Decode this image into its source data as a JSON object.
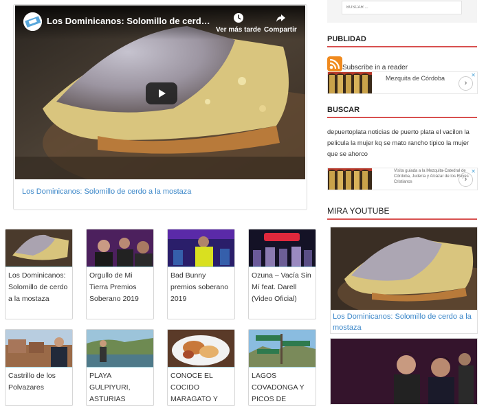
{
  "main_video": {
    "title": "Los Dominicanos: Solomillo de cerdo a la ...",
    "watch_later": "Ver más tarde",
    "share": "Compartir",
    "link_text": "Los Dominicanos: Solomillo de cerdo a la mostaza"
  },
  "grid": [
    {
      "title": "Los Dominicanos: Solomillo de cerdo a la mostaza"
    },
    {
      "title": "Orgullo de Mi Tierra Premios Soberano 2019"
    },
    {
      "title": "Bad Bunny premios soberano 2019"
    },
    {
      "title": "Ozuna – Vacía Sin Mí feat. Darell (Video Oficial)"
    },
    {
      "title": "Castrillo de los Polvazares"
    },
    {
      "title": "PLAYA GULPIYURI, ASTURIAS"
    },
    {
      "title": "CONOCE EL COCIDO MARAGATO Y"
    },
    {
      "title": "LAGOS COVADONGA Y PICOS DE"
    }
  ],
  "sidebar": {
    "search_placeholder": "BUSCAR ...",
    "publicidad_title": "PUBLIDAD",
    "rss_label": "Subscribe in a reader",
    "ad1_text": "Mezquita de Córdoba",
    "buscar_title": "BUSCAR",
    "tags": "depuertoplata noticias de puerto plata el vacilon la pelicula la mujer kq se mato rancho tipico la mujer que se ahorco",
    "ad2_text": "Visita guiada a la Mezquita-Catedral de Córdoba, Judería y Alcázar de los Reyes Cristianos",
    "mira_title": "MIRA YOUTUBE",
    "yt1_caption": "Los Dominicanos: Solomillo de cerdo a la mostaza"
  },
  "colors": {
    "accent": "#d8504f",
    "link": "#3a86c8",
    "rss": "#f08a1e"
  },
  "icons": [
    "play-icon",
    "clock-icon",
    "share-icon",
    "rss-icon",
    "chevron-right-icon",
    "close-icon"
  ]
}
